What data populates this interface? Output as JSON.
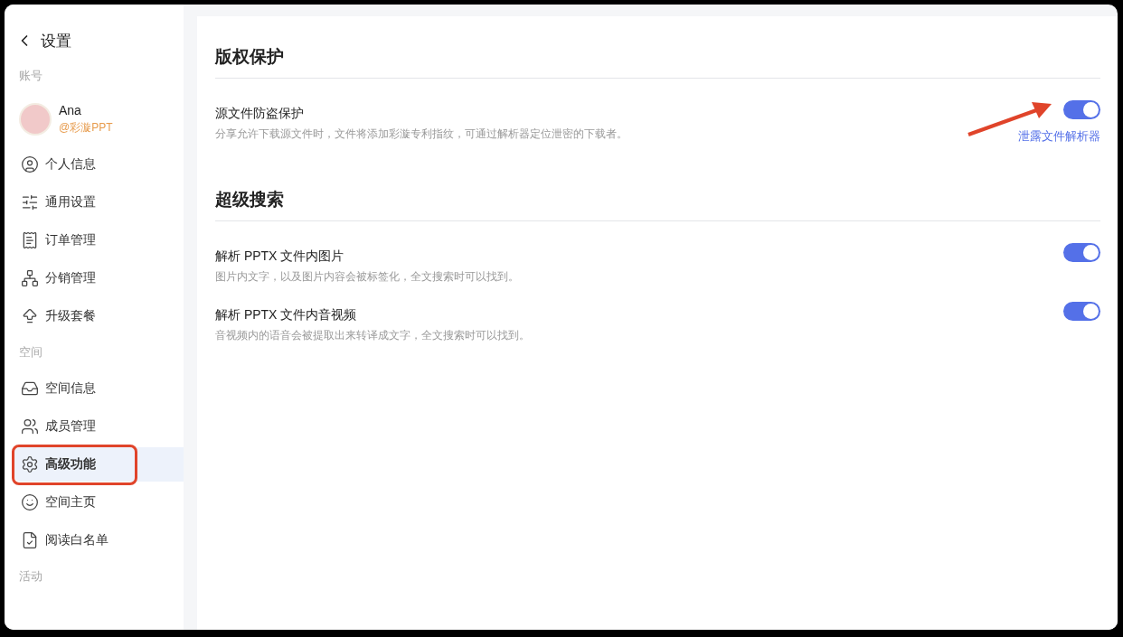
{
  "header": {
    "title": "设置"
  },
  "sidebar": {
    "sections": [
      {
        "label": "账号",
        "account": {
          "name": "Ana",
          "handle": "@彩漩PPT"
        },
        "items": [
          {
            "label": "个人信息",
            "selected": false,
            "highlighted": false
          },
          {
            "label": "通用设置",
            "selected": false,
            "highlighted": false
          },
          {
            "label": "订单管理",
            "selected": false,
            "highlighted": false
          },
          {
            "label": "分销管理",
            "selected": false,
            "highlighted": false
          },
          {
            "label": "升级套餐",
            "selected": false,
            "highlighted": false
          }
        ]
      },
      {
        "label": "空间",
        "items": [
          {
            "label": "空间信息",
            "selected": false,
            "highlighted": false
          },
          {
            "label": "成员管理",
            "selected": false,
            "highlighted": false
          },
          {
            "label": "高级功能",
            "selected": true,
            "highlighted": true
          },
          {
            "label": "空间主页",
            "selected": false,
            "highlighted": false
          },
          {
            "label": "阅读白名单",
            "selected": false,
            "highlighted": false
          }
        ]
      },
      {
        "label": "活动"
      }
    ]
  },
  "main": {
    "sections": [
      {
        "title": "版权保护",
        "settings": [
          {
            "title": "源文件防盗保护",
            "description": "分享允许下载源文件时，文件将添加彩漩专利指纹，可通过解析器定位泄密的下载者。",
            "on": true,
            "link": "泄露文件解析器",
            "arrow": true
          }
        ]
      },
      {
        "title": "超级搜索",
        "settings": [
          {
            "title": "解析 PPTX 文件内图片",
            "description": "图片内文字，以及图片内容会被标签化，全文搜索时可以找到。",
            "on": true
          },
          {
            "title": "解析 PPTX 文件内音视频",
            "description": "音视频内的语音会被提取出来转译成文字，全文搜索时可以找到。",
            "on": true
          }
        ]
      }
    ]
  }
}
